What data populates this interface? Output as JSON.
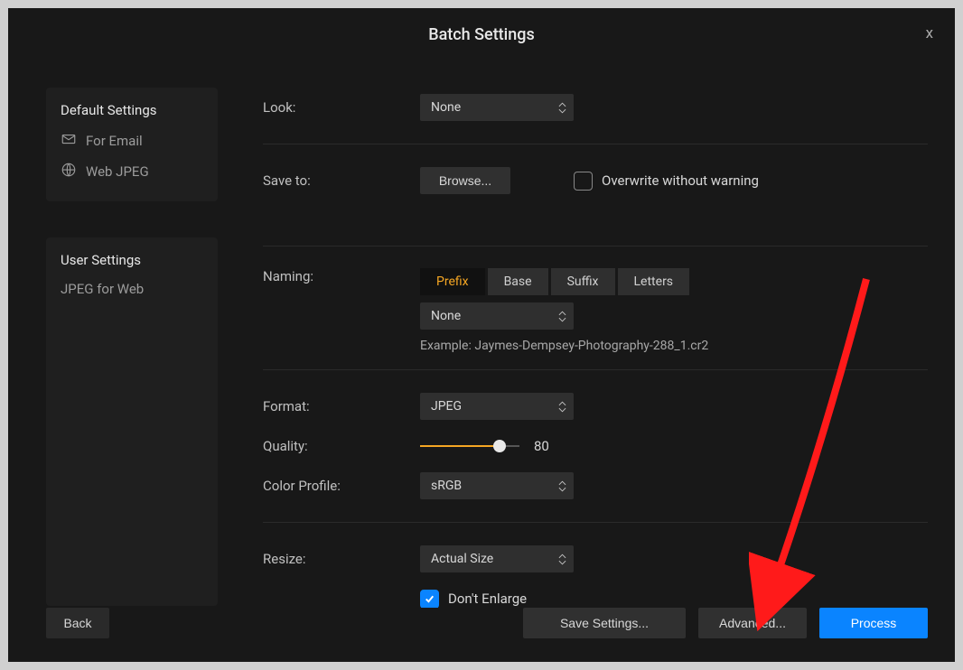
{
  "window": {
    "title": "Batch Settings"
  },
  "sidebar": {
    "default_header": "Default Settings",
    "default_items": [
      "For Email",
      "Web JPEG"
    ],
    "user_header": "User Settings",
    "user_items": [
      "JPEG for Web"
    ]
  },
  "look": {
    "label": "Look:",
    "value": "None"
  },
  "save_to": {
    "label": "Save to:",
    "browse": "Browse...",
    "overwrite": "Overwrite without warning",
    "overwrite_checked": false
  },
  "naming": {
    "label": "Naming:",
    "segments": [
      "Prefix",
      "Base",
      "Suffix",
      "Letters"
    ],
    "active": 0,
    "select_value": "None",
    "example": "Example: Jaymes-Dempsey-Photography-288_1.cr2"
  },
  "format": {
    "label": "Format:",
    "value": "JPEG"
  },
  "quality": {
    "label": "Quality:",
    "value": 80,
    "pct": 80
  },
  "color_profile": {
    "label": "Color Profile:",
    "value": "sRGB"
  },
  "resize": {
    "label": "Resize:",
    "value": "Actual Size",
    "dont_enlarge": "Don't Enlarge",
    "dont_enlarge_checked": true
  },
  "footer": {
    "back": "Back",
    "save": "Save Settings...",
    "advanced": "Advanced...",
    "process": "Process"
  }
}
